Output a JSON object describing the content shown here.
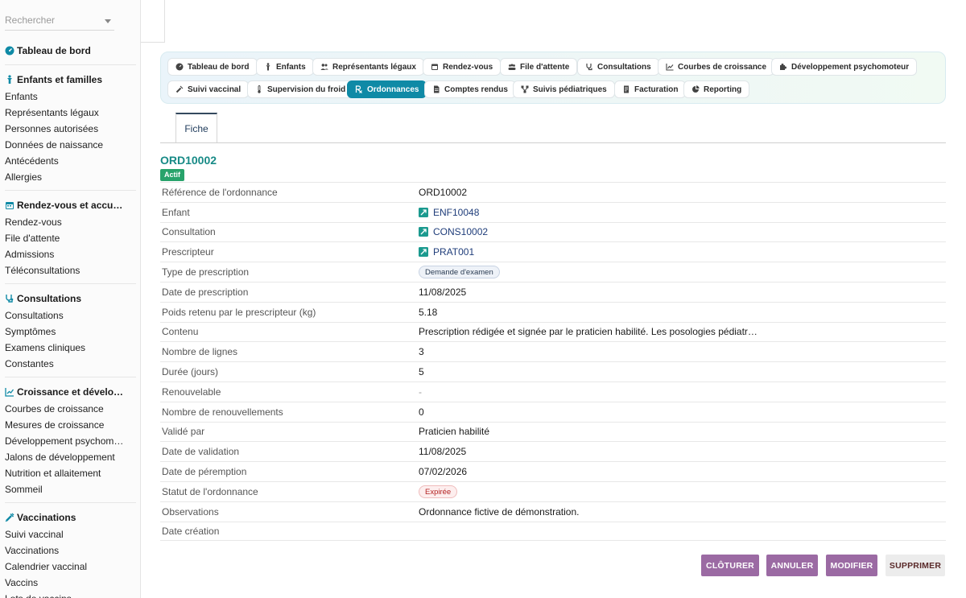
{
  "search": {
    "placeholder": "Rechercher"
  },
  "sidebar": {
    "dashboard": "Tableau de bord",
    "groups": [
      {
        "title": "Enfants et familles",
        "items": [
          "Enfants",
          "Représentants légaux",
          "Personnes autorisées",
          "Données de naissance",
          "Antécédents",
          "Allergies"
        ]
      },
      {
        "title": "Rendez-vous et accu…",
        "items": [
          "Rendez-vous",
          "File d'attente",
          "Admissions",
          "Téléconsultations"
        ]
      },
      {
        "title": "Consultations",
        "items": [
          "Consultations",
          "Symptômes",
          "Examens cliniques",
          "Constantes"
        ]
      },
      {
        "title": "Croissance et dévelo…",
        "items": [
          "Courbes de croissance",
          "Mesures de croissance",
          "Développement psychom…",
          "Jalons de développement",
          "Nutrition et allaitement",
          "Sommeil"
        ]
      },
      {
        "title": "Vaccinations",
        "items": [
          "Suivi vaccinal",
          "Vaccinations",
          "Calendrier vaccinal",
          "Vaccins",
          "Lots de vaccins"
        ]
      }
    ]
  },
  "tabs": [
    {
      "label": "Tableau de bord",
      "icon": "dashboard-icon"
    },
    {
      "label": "Enfants",
      "icon": "child-icon"
    },
    {
      "label": "Représentants légaux",
      "icon": "users-icon"
    },
    {
      "label": "Rendez-vous",
      "icon": "calendar-icon"
    },
    {
      "label": "File d'attente",
      "icon": "queue-icon"
    },
    {
      "label": "Consultations",
      "icon": "stethoscope-icon"
    },
    {
      "label": "Courbes de croissance",
      "icon": "chart-icon"
    },
    {
      "label": "Développement psychomoteur",
      "icon": "puzzle-icon"
    },
    {
      "label": "Suivi vaccinal",
      "icon": "syringe-icon"
    },
    {
      "label": "Supervision du froid",
      "icon": "thermometer-icon"
    },
    {
      "label": "Ordonnances",
      "icon": "prescription-icon",
      "active": true
    },
    {
      "label": "Comptes rendus",
      "icon": "document-icon"
    },
    {
      "label": "Suivis pédiatriques",
      "icon": "network-icon"
    },
    {
      "label": "Facturation",
      "icon": "invoice-icon"
    },
    {
      "label": "Reporting",
      "icon": "pie-icon"
    }
  ],
  "record": {
    "subtab": "Fiche",
    "title": "ORD10002",
    "status_badge": "Actif",
    "fields": [
      {
        "label": "Référence de l'ordonnance",
        "value": "ORD10002",
        "kind": "text"
      },
      {
        "label": "Enfant",
        "value": "ENF10048",
        "kind": "link"
      },
      {
        "label": "Consultation",
        "value": "CONS10002",
        "kind": "link"
      },
      {
        "label": "Prescripteur",
        "value": "PRAT001",
        "kind": "link"
      },
      {
        "label": "Type de prescription",
        "value": "Demande d'examen",
        "kind": "pill"
      },
      {
        "label": "Date de prescription",
        "value": "11/08/2025",
        "kind": "text"
      },
      {
        "label": "Poids retenu par le prescripteur (kg)",
        "value": "5.18",
        "kind": "text"
      },
      {
        "label": "Contenu",
        "value": "Prescription rédigée et signée par le praticien habilité. Les posologies pédiatr…",
        "kind": "text"
      },
      {
        "label": "Nombre de lignes",
        "value": "3",
        "kind": "text"
      },
      {
        "label": "Durée (jours)",
        "value": "5",
        "kind": "text"
      },
      {
        "label": "Renouvelable",
        "value": "-",
        "kind": "muted"
      },
      {
        "label": "Nombre de renouvellements",
        "value": "0",
        "kind": "text"
      },
      {
        "label": "Validé par",
        "value": "Praticien habilité",
        "kind": "text"
      },
      {
        "label": "Date de validation",
        "value": "11/08/2025",
        "kind": "text"
      },
      {
        "label": "Date de péremption",
        "value": "07/02/2026",
        "kind": "text"
      },
      {
        "label": "Statut de l'ordonnance",
        "value": "Expirée",
        "kind": "pill-red"
      },
      {
        "label": "Observations",
        "value": "Ordonnance fictive de démonstration.",
        "kind": "text"
      },
      {
        "label": "Date création",
        "value": "",
        "kind": "text"
      }
    ]
  },
  "actions": {
    "close": "CLÔTURER",
    "cancel": "ANNULER",
    "edit": "MODIFIER",
    "delete": "SUPPRIMER"
  },
  "colors": {
    "accent": "#0f8aa6",
    "title": "#178a86",
    "badge": "#28a36b",
    "button": "#9b6aa3"
  }
}
